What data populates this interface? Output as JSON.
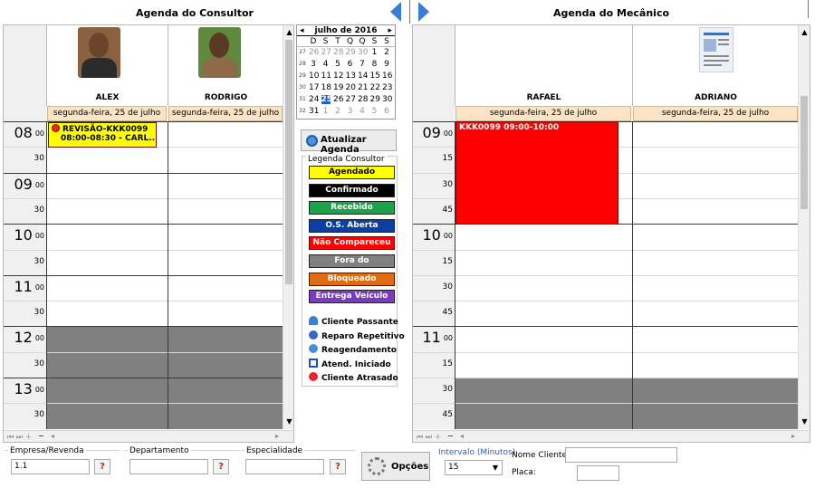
{
  "consultor_title": "Agenda do Consultor",
  "mecanico_title": "Agenda do Mecânico",
  "consultor": {
    "columns": [
      {
        "name": "ALEX",
        "date": "segunda-feira, 25 de julho"
      },
      {
        "name": "RODRIGO",
        "date": "segunda-feira, 25 de julho"
      }
    ],
    "times": [
      {
        "h": "08",
        "m": "00"
      },
      {
        "m": "30"
      },
      {
        "h": "09",
        "m": "00"
      },
      {
        "m": "30"
      },
      {
        "h": "10",
        "m": "00"
      },
      {
        "m": "30"
      },
      {
        "h": "11",
        "m": "00"
      },
      {
        "m": "30"
      },
      {
        "h": "12",
        "m": "00"
      },
      {
        "m": "30"
      },
      {
        "h": "13",
        "m": "00"
      },
      {
        "m": "30"
      }
    ],
    "event": {
      "line1": "REVISÃO-KKK0099",
      "line2": "08:00-08:30 - CARL..."
    }
  },
  "mecanico": {
    "columns": [
      {
        "name": "RAFAEL",
        "date": "segunda-feira, 25 de julho"
      },
      {
        "name": "ADRIANO",
        "date": "segunda-feira, 25 de julho"
      }
    ],
    "times": [
      {
        "h": "09",
        "m": "00"
      },
      {
        "m": "15"
      },
      {
        "m": "30"
      },
      {
        "m": "45"
      },
      {
        "h": "10",
        "m": "00"
      },
      {
        "m": "15"
      },
      {
        "m": "30"
      },
      {
        "m": "45"
      },
      {
        "h": "11",
        "m": "00"
      },
      {
        "m": "15"
      },
      {
        "m": "30"
      },
      {
        "m": "45"
      }
    ],
    "event": {
      "label": "KKK0099 09:00-10:00"
    }
  },
  "calendar": {
    "month": "julho de 2016",
    "days_header": [
      "D",
      "S",
      "T",
      "Q",
      "Q",
      "S",
      "S"
    ],
    "weeks": [
      {
        "wk": "27",
        "days": [
          "26",
          "27",
          "28",
          "29",
          "30",
          "1",
          "2"
        ]
      },
      {
        "wk": "28",
        "days": [
          "3",
          "4",
          "5",
          "6",
          "7",
          "8",
          "9"
        ]
      },
      {
        "wk": "29",
        "days": [
          "10",
          "11",
          "12",
          "13",
          "14",
          "15",
          "16"
        ]
      },
      {
        "wk": "30",
        "days": [
          "17",
          "18",
          "19",
          "20",
          "21",
          "22",
          "23"
        ]
      },
      {
        "wk": "31",
        "days": [
          "24",
          "25",
          "26",
          "27",
          "28",
          "29",
          "30"
        ]
      },
      {
        "wk": "32",
        "days": [
          "31",
          "1",
          "2",
          "3",
          "4",
          "5",
          "6"
        ]
      }
    ],
    "selected_day": "25"
  },
  "refresh_button": "Atualizar Agenda",
  "legend_title": "Legenda Consultor",
  "legend": [
    {
      "label": "Agendado",
      "bg": "#ffff00",
      "fg": "#000000"
    },
    {
      "label": "Confirmado",
      "bg": "#000000",
      "fg": "#ffffff"
    },
    {
      "label": "Recebido",
      "bg": "#1aa34a",
      "fg": "#ffffff"
    },
    {
      "label": "O.S. Aberta",
      "bg": "#0b3fa8",
      "fg": "#ffffff"
    },
    {
      "label": "Não Compareceu",
      "bg": "#ff0000",
      "fg": "#ffffff"
    },
    {
      "label": "Fora do Expediente",
      "bg": "#808080",
      "fg": "#ffffff"
    },
    {
      "label": "Bloqueado",
      "bg": "#e06c10",
      "fg": "#ffffff"
    },
    {
      "label": "Entrega Veículo",
      "bg": "#7a3bc2",
      "fg": "#ffffff"
    }
  ],
  "legend_icons": [
    {
      "icon": "person-icon",
      "label": "Cliente Passante"
    },
    {
      "icon": "repeat-icon",
      "label": "Reparo Repetitivo"
    },
    {
      "icon": "reschedule-icon",
      "label": "Reagendamento"
    },
    {
      "icon": "square-outline-icon",
      "label": "Atend. Iniciado"
    },
    {
      "icon": "late-clock-icon",
      "label": "Cliente Atrasado"
    }
  ],
  "filters": {
    "empresa_label": "Empresa/Revenda",
    "empresa_value": "1.1",
    "departamento_label": "Departamento",
    "departamento_value": "",
    "especialidade_label": "Especialidade",
    "especialidade_value": "",
    "options_button": "Opções",
    "intervalo_label": "Intervalo (Minutos)",
    "intervalo_value": "15",
    "nome_cliente_label": "Nome Cliente:",
    "nome_cliente_value": "",
    "placa_label": "Placa:",
    "placa_value": ""
  },
  "colors": {
    "accent": "#2a6fd0",
    "event_yellow": "#ffff00",
    "event_red": "#ff0000"
  }
}
